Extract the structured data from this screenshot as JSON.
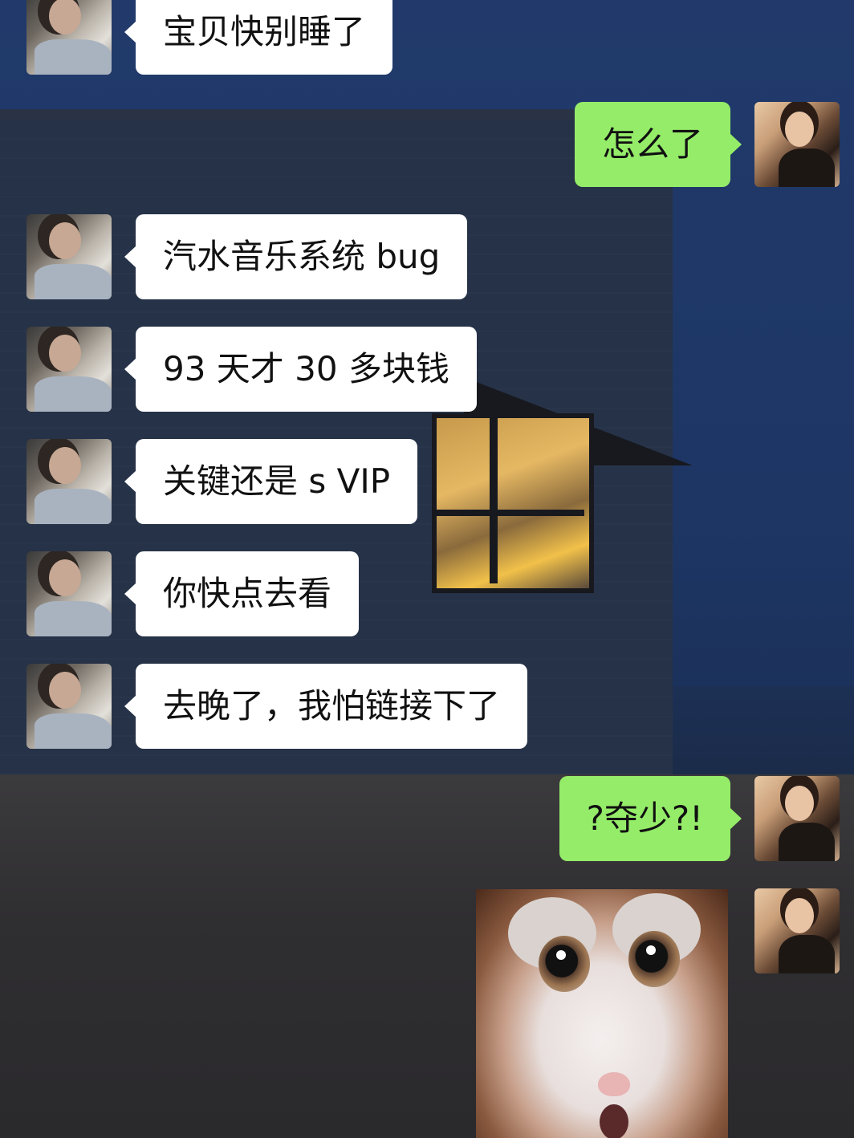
{
  "chat": {
    "messages": [
      {
        "sender": "contact",
        "type": "text",
        "text": "宝贝快别睡了"
      },
      {
        "sender": "me",
        "type": "text",
        "text": "怎么了"
      },
      {
        "sender": "contact",
        "type": "text",
        "text": "汽水音乐系统 bug"
      },
      {
        "sender": "contact",
        "type": "text",
        "text": "93 天才 30 多块钱"
      },
      {
        "sender": "contact",
        "type": "text",
        "text": "关键还是 s VIP"
      },
      {
        "sender": "contact",
        "type": "text",
        "text": "你快点去看"
      },
      {
        "sender": "contact",
        "type": "text",
        "text": "去晚了，我怕链接下了"
      },
      {
        "sender": "me",
        "type": "text",
        "text": "?夺少?!"
      },
      {
        "sender": "me",
        "type": "sticker",
        "sticker": "surprised-cat-sticker"
      }
    ]
  },
  "theme": {
    "incoming_bubble_color": "#ffffff",
    "outgoing_bubble_color": "#95ec69"
  }
}
